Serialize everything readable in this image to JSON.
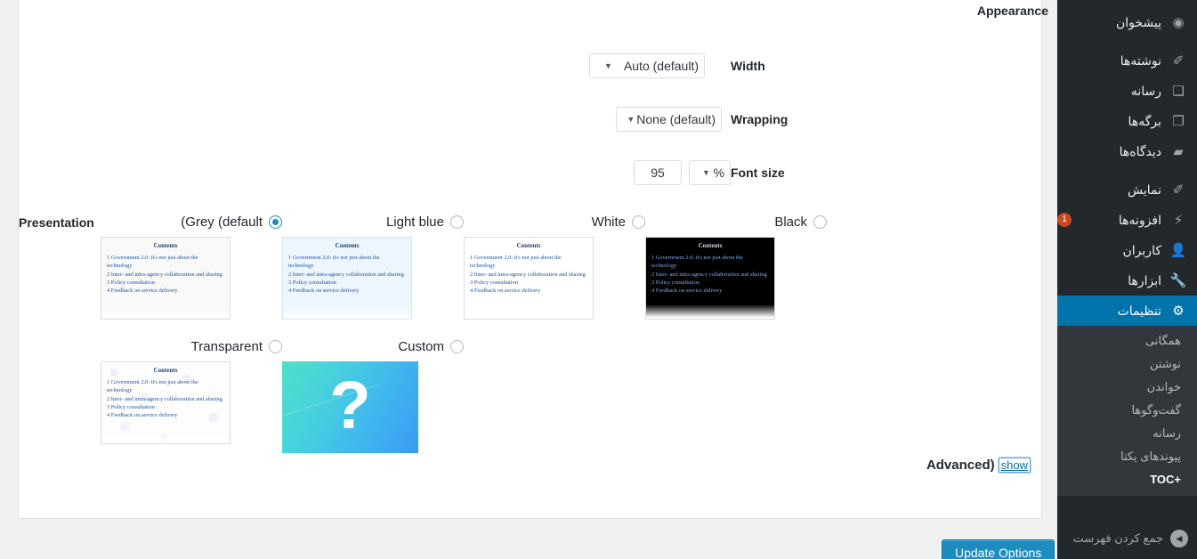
{
  "sidebar": {
    "items": [
      {
        "label": "پیشخوان",
        "icon": "dashboard-icon",
        "glyph": "◉",
        "name": "sidebar-item-dashboard",
        "sep_after": true
      },
      {
        "label": "نوشته‌ها",
        "icon": "pin-icon",
        "glyph": "✎",
        "name": "sidebar-item-posts"
      },
      {
        "label": "رسانه",
        "icon": "media-icon",
        "glyph": "♬",
        "name": "sidebar-item-media"
      },
      {
        "label": "برگه‌ها",
        "icon": "page-icon",
        "glyph": "❐",
        "name": "sidebar-item-pages"
      },
      {
        "label": "دیدگاه‌ها",
        "icon": "comment-icon",
        "glyph": "🗩",
        "name": "sidebar-item-comments",
        "sep_after": true
      },
      {
        "label": "نمایش",
        "icon": "appearance-icon",
        "glyph": "✎",
        "name": "sidebar-item-appearance"
      },
      {
        "label": "افزونه‌ها",
        "icon": "plugins-icon",
        "glyph": "⚡",
        "name": "sidebar-item-plugins",
        "badge": "1"
      },
      {
        "label": "کاربران",
        "icon": "users-icon",
        "glyph": "👤",
        "name": "sidebar-item-users"
      },
      {
        "label": "ابزارها",
        "icon": "tools-icon",
        "glyph": "🔧",
        "name": "sidebar-item-tools"
      },
      {
        "label": "تنظیمات",
        "icon": "settings-icon",
        "glyph": "⚙",
        "name": "sidebar-item-settings",
        "current": true
      }
    ],
    "submenu": [
      {
        "label": "همگانی",
        "name": "submenu-item-general"
      },
      {
        "label": "نوشتن",
        "name": "submenu-item-writing"
      },
      {
        "label": "خواندن",
        "name": "submenu-item-reading"
      },
      {
        "label": "گفت‌وگوها",
        "name": "submenu-item-discussion"
      },
      {
        "label": "رسانه",
        "name": "submenu-item-media"
      },
      {
        "label": "پیوندهای یکتا",
        "name": "submenu-item-permalinks"
      },
      {
        "label": "+TOC",
        "name": "submenu-item-toc",
        "active": true
      }
    ],
    "collapse": {
      "label": "جمع کردن فهرست",
      "icon": "collapse-arrow-icon",
      "glyph": "◀"
    },
    "colors": {
      "background": "#23282d",
      "submenu_background": "#32373c",
      "current": "#0073aa",
      "badge": "#ca4a1f"
    }
  },
  "form": {
    "appearance_heading": "Appearance",
    "rows": [
      {
        "label": "Width",
        "value": "(Auto (default",
        "name": "width-select"
      },
      {
        "label": "Wrapping",
        "value": "(None (default",
        "name": "wrapping-select"
      }
    ],
    "font_size": {
      "label": "Font size",
      "value": "95",
      "unit": "%"
    },
    "presentation_label": "Presentation"
  },
  "presentation": {
    "options": [
      {
        "label": "(Grey (default",
        "value": "grey",
        "checked": true,
        "name": "presentation-option-grey"
      },
      {
        "label": "Light blue",
        "value": "lightblue",
        "checked": false,
        "name": "presentation-option-light-blue"
      },
      {
        "label": "White",
        "value": "white",
        "checked": false,
        "name": "presentation-option-white"
      },
      {
        "label": "Black",
        "value": "black",
        "checked": false,
        "name": "presentation-option-black"
      },
      {
        "label": "Transparent",
        "value": "transparent",
        "checked": false,
        "name": "presentation-option-transparent"
      },
      {
        "label": "Custom",
        "value": "custom",
        "checked": false,
        "name": "presentation-option-custom"
      }
    ],
    "thumbnail": {
      "title": "Contents",
      "items": [
        "1 Government 2.0: it's not just about the technology",
        "2 Inter- and intra-agency collaboration and sharing",
        "3 Policy consultation",
        "4 Feedback on service delivery"
      ]
    },
    "custom_placeholder": "?"
  },
  "advanced": {
    "title": "(Advanced",
    "toggle": "show"
  },
  "footer": {
    "submit_label": "Update Options"
  }
}
